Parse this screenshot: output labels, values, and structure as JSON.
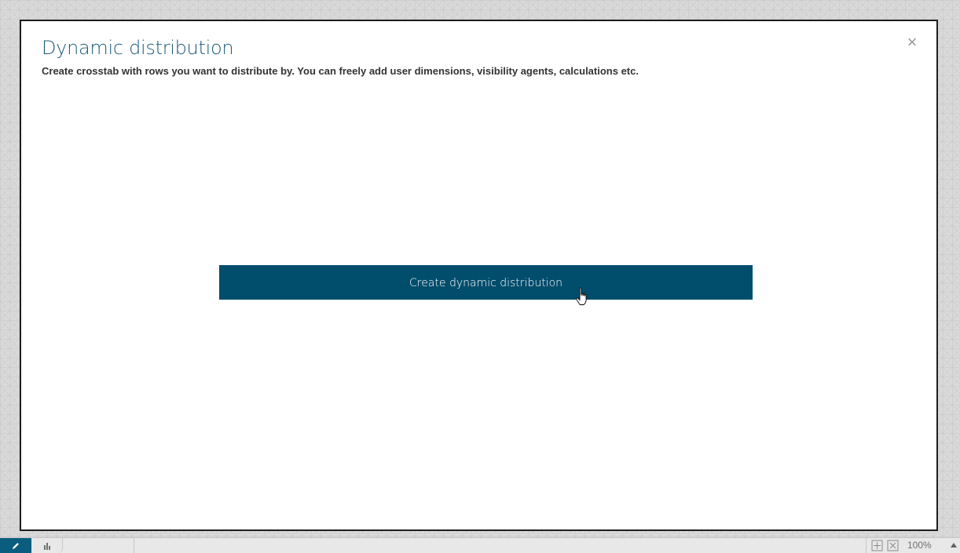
{
  "dialog": {
    "title": "Dynamic distribution",
    "subtitle": "Create crosstab with rows you want to distribute by. You can freely add user dimensions, visibility agents, calculations etc.",
    "close_glyph": "×",
    "create_button_label": "Create dynamic distribution"
  },
  "bottombar": {
    "zoom": "100%",
    "icons": [
      "pencil-icon",
      "bar-chart-icon",
      "fit-to-screen-icon",
      "fullscreen-icon",
      "caret-up-icon"
    ]
  },
  "colors": {
    "title": "#1d5a78",
    "button": "#004d6c",
    "edit_tab": "#0a5d7e"
  }
}
